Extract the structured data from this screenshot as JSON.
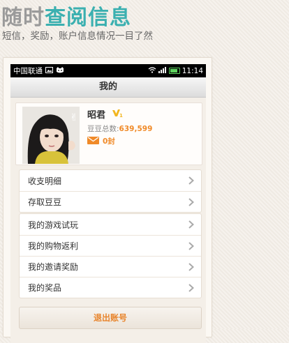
{
  "banner": {
    "headline_gray": "随时",
    "headline_teal": "查阅信息",
    "subline": "短信，奖励，账户信息情况一目了然",
    "accent_color": "#3bb0b0"
  },
  "status_bar": {
    "carrier": "中国联通",
    "time": "11:14"
  },
  "screen": {
    "title": "我的"
  },
  "profile": {
    "nickname": "昭君",
    "beans_label": "豆豆总数:",
    "beans_value": "639,599",
    "mail_count": "0封"
  },
  "menu_group1": [
    {
      "label": "收支明细"
    },
    {
      "label": "存取豆豆"
    }
  ],
  "menu_group2": [
    {
      "label": "我的游戏试玩"
    },
    {
      "label": "我的购物返利"
    },
    {
      "label": "我的邀请奖励"
    },
    {
      "label": "我的奖品"
    }
  ],
  "logout_label": "退出账号"
}
